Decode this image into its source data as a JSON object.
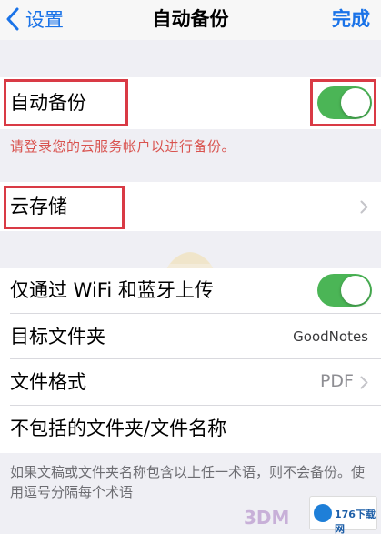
{
  "nav": {
    "back_label": "设置",
    "title": "自动备份",
    "done_label": "完成"
  },
  "auto_backup": {
    "label": "自动备份",
    "enabled": true,
    "warning": "请登录您的云服务帐户以进行备份。"
  },
  "cloud_storage": {
    "label": "云存储"
  },
  "settings": {
    "wifi_bluetooth_label": "仅通过 WiFi 和蓝牙上传",
    "wifi_bluetooth_enabled": true,
    "target_folder_label": "目标文件夹",
    "target_folder_value": "GoodNotes",
    "file_format_label": "文件格式",
    "file_format_value": "PDF",
    "exclude_label": "不包括的文件夹/文件名称"
  },
  "footer": {
    "note": "如果文稿或文件夹名称包含以上任一术语，则不会备份。使用逗号分隔每个术语"
  },
  "colors": {
    "accent": "#1a73e8",
    "toggle_on": "#4bb556",
    "highlight": "#d93a45"
  },
  "watermark": {
    "text_3dm": "3DM",
    "site_logo_text": "176下载网"
  }
}
